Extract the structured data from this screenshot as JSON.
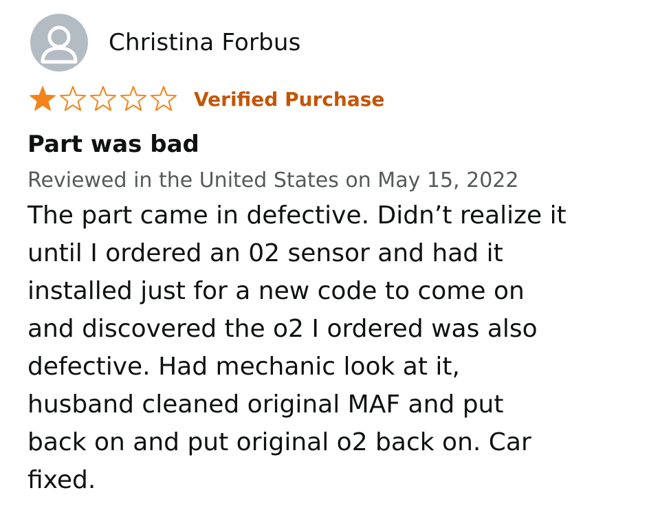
{
  "reviewer": {
    "name": "Christina Forbus",
    "avatar_icon": "person-icon"
  },
  "rating": {
    "value": 1,
    "max": 5,
    "star_filled_color": "#f1841b",
    "star_empty_color": "#f1841b"
  },
  "badge": {
    "label": "Verified Purchase",
    "color": "#c45500"
  },
  "review": {
    "title": "Part was bad",
    "date_line": "Reviewed in the United States on May 15, 2022",
    "body_lines": [
      "The part came in defective. Didn’t realize it",
      "until I ordered an 02 sensor and had it",
      "installed just for a new code to come on",
      "and discovered the o2 I ordered was also",
      "defective. Had mechanic look at it,",
      "husband cleaned original MAF and put",
      "back on and put original o2 back on. Car",
      "fixed."
    ]
  }
}
